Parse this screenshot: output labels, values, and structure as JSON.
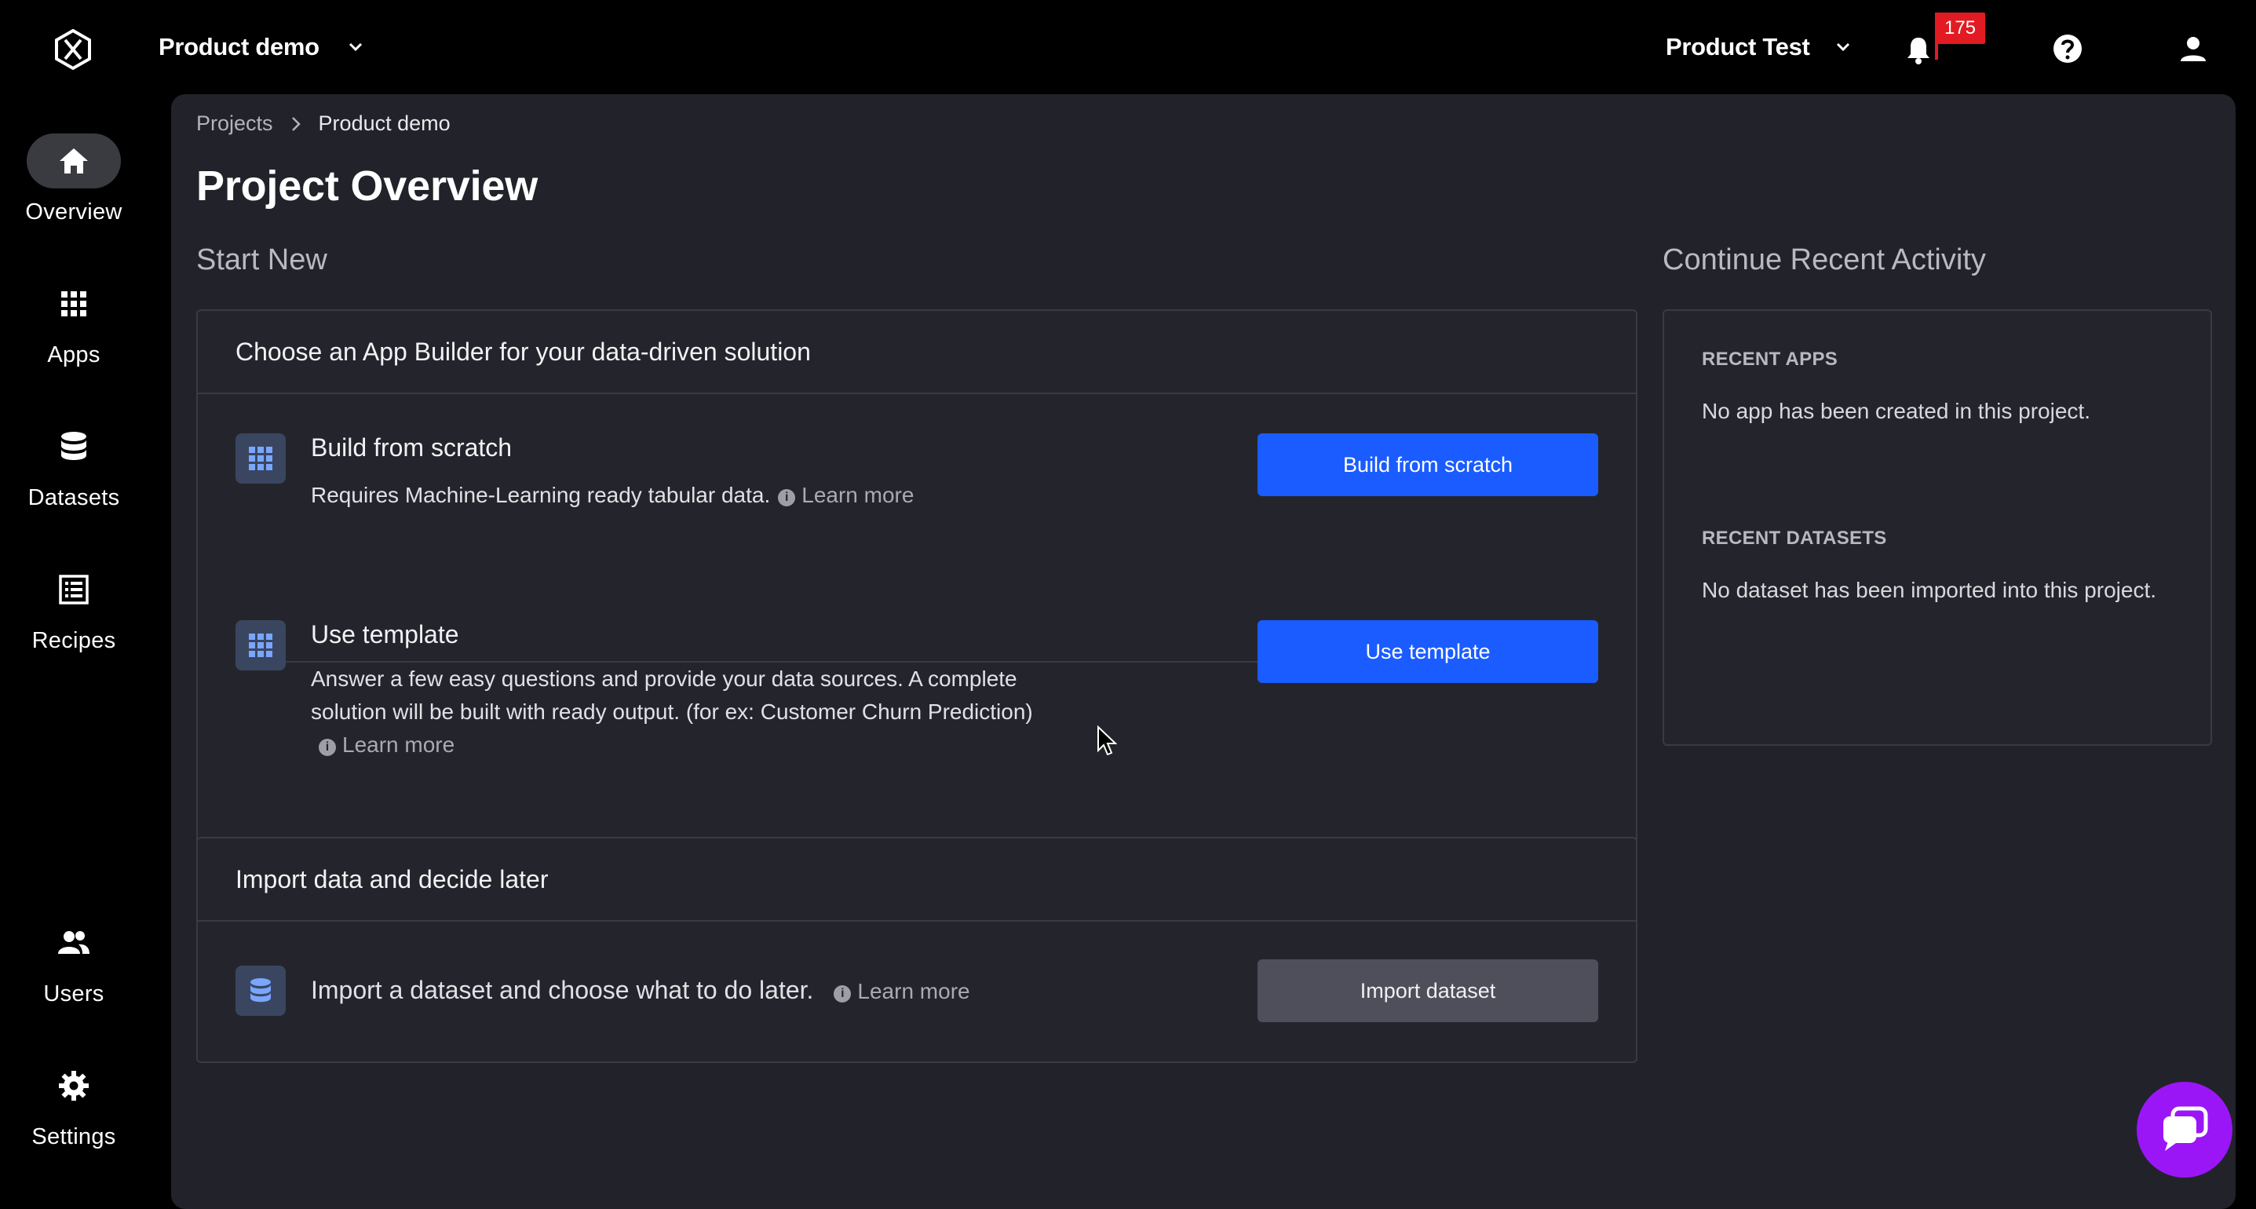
{
  "header": {
    "project_name": "Product demo",
    "org_name": "Product Test",
    "notification_count": "175"
  },
  "nav": {
    "items": [
      {
        "label": "Overview",
        "icon": "home-icon",
        "active": true
      },
      {
        "label": "Apps",
        "icon": "grid-icon"
      },
      {
        "label": "Datasets",
        "icon": "database-icon"
      },
      {
        "label": "Recipes",
        "icon": "list-icon"
      },
      {
        "label": "Users",
        "icon": "users-icon"
      },
      {
        "label": "Settings",
        "icon": "gear-icon"
      }
    ]
  },
  "breadcrumb": {
    "root": "Projects",
    "current": "Product demo"
  },
  "page": {
    "title": "Project Overview",
    "start_new": "Start New",
    "continue_recent": "Continue Recent Activity"
  },
  "app_builder": {
    "heading": "Choose an App Builder for your data-driven solution",
    "scratch": {
      "title": "Build from scratch",
      "desc": "Requires Machine-Learning ready tabular data.",
      "learn": "Learn more",
      "button": "Build from scratch"
    },
    "template": {
      "title": "Use template",
      "desc": "Answer a few easy questions and provide your data sources. A complete solution will be built with ready output. (for ex: Customer Churn Prediction)",
      "learn": "Learn more",
      "button": "Use template"
    }
  },
  "import": {
    "heading": "Import data and decide later",
    "desc": "Import a dataset and choose what to do later.",
    "learn": "Learn more",
    "button": "Import dataset"
  },
  "recent": {
    "apps_heading": "RECENT APPS",
    "apps_empty": "No app has been created in this project.",
    "datasets_heading": "RECENT DATASETS",
    "datasets_empty": "No dataset has been imported into this project."
  },
  "colors": {
    "primary": "#1a5cff",
    "badge": "#e21b23",
    "chat": "#9b16f7",
    "panel": "#22232a"
  }
}
